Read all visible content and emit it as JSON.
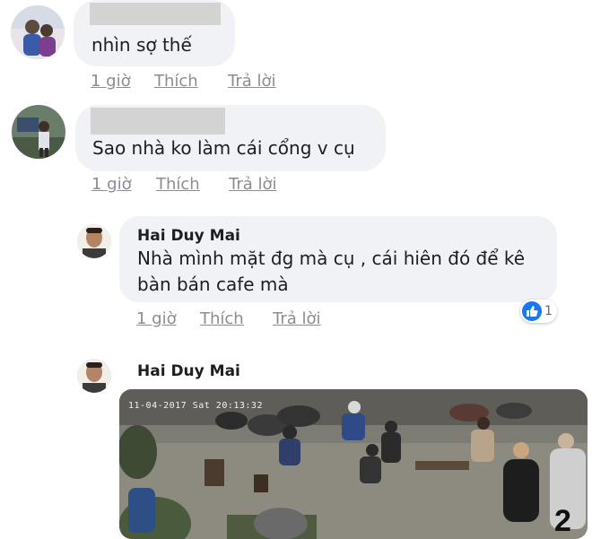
{
  "actions": {
    "time": "1 giờ",
    "like": "Thích",
    "reply": "Trả lời"
  },
  "comments": [
    {
      "author": "",
      "text": "nhìn sợ thế"
    },
    {
      "author": "",
      "text": "Sao nhà ko làm cái cổng v cụ"
    }
  ],
  "replies": [
    {
      "author": "Hai Duy Mai",
      "text_lines": [
        "Nhà mình mặt đg mà cụ , cái hiên đó để kê",
        "bàn bán cafe mà"
      ],
      "like_count": "1"
    },
    {
      "author": "Hai Duy Mai",
      "photo": {
        "timestamp": "11-04-2017 Sat 20:13:32",
        "camera_label": "2"
      }
    }
  ],
  "colors": {
    "like_blue": "#1877f2",
    "bubble_bg": "#f0f2f5",
    "action_gray": "#8a8d91"
  }
}
